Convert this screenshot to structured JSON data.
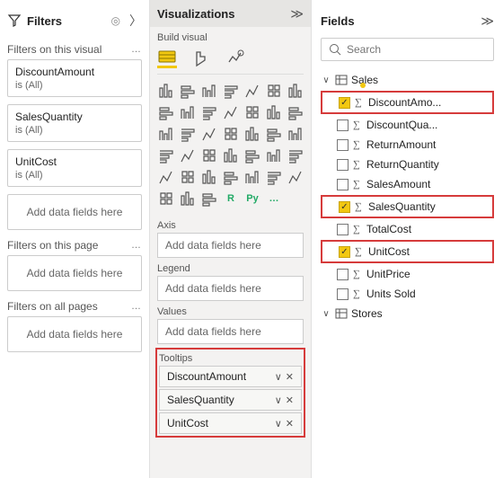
{
  "filters": {
    "title": "Filters",
    "visual_label": "Filters on this visual",
    "page_label": "Filters on this page",
    "all_label": "Filters on all pages",
    "add_placeholder": "Add data fields here",
    "cards": [
      {
        "name": "DiscountAmount",
        "state": "is (All)"
      },
      {
        "name": "SalesQuantity",
        "state": "is (All)"
      },
      {
        "name": "UnitCost",
        "state": "is (All)"
      }
    ]
  },
  "vis": {
    "title": "Visualizations",
    "build": "Build visual",
    "wells": {
      "axis_label": "Axis",
      "axis_placeholder": "Add data fields here",
      "legend_label": "Legend",
      "legend_placeholder": "Add data fields here",
      "values_label": "Values",
      "values_placeholder": "Add data fields here",
      "tooltips_label": "Tooltips",
      "tooltips": [
        {
          "name": "DiscountAmount"
        },
        {
          "name": "SalesQuantity"
        },
        {
          "name": "UnitCost"
        }
      ]
    }
  },
  "fields": {
    "title": "Fields",
    "search_placeholder": "Search",
    "tables": [
      {
        "name": "Sales",
        "expanded": true,
        "fields": [
          {
            "name": "DiscountAmo...",
            "checked": true,
            "sigma": true,
            "highlight": true
          },
          {
            "name": "DiscountQua...",
            "checked": false,
            "sigma": true,
            "highlight": false
          },
          {
            "name": "ReturnAmount",
            "checked": false,
            "sigma": true,
            "highlight": false
          },
          {
            "name": "ReturnQuantity",
            "checked": false,
            "sigma": true,
            "highlight": false
          },
          {
            "name": "SalesAmount",
            "checked": false,
            "sigma": true,
            "highlight": false
          },
          {
            "name": "SalesQuantity",
            "checked": true,
            "sigma": true,
            "highlight": true
          },
          {
            "name": "TotalCost",
            "checked": false,
            "sigma": true,
            "highlight": false
          },
          {
            "name": "UnitCost",
            "checked": true,
            "sigma": true,
            "highlight": true
          },
          {
            "name": "UnitPrice",
            "checked": false,
            "sigma": true,
            "highlight": false
          },
          {
            "name": "Units Sold",
            "checked": false,
            "sigma": true,
            "highlight": false
          }
        ]
      },
      {
        "name": "Stores",
        "expanded": false,
        "fields": []
      }
    ]
  }
}
